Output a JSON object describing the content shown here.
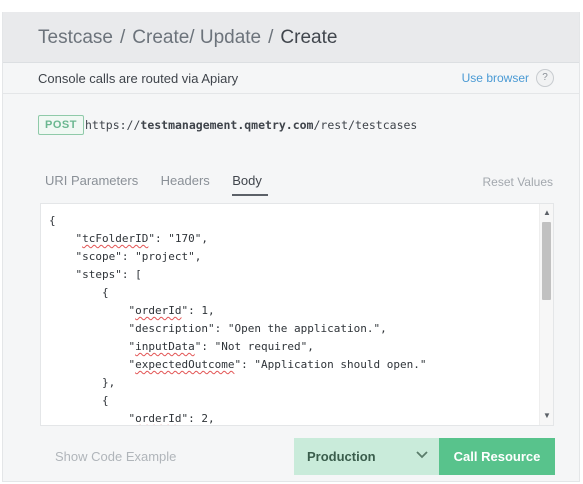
{
  "breadcrumb": {
    "items": [
      "Testcase",
      "Create/ Update",
      "Create"
    ],
    "separator": "/"
  },
  "console": {
    "text": "Console calls are routed via Apiary",
    "use_browser": "Use browser",
    "help": "?"
  },
  "request": {
    "method": "POST",
    "url_prefix": "https://",
    "url_host": "testmanagement.qmetry.com",
    "url_path": "/rest/testcases"
  },
  "tabs": [
    {
      "label": "URI Parameters",
      "active": false
    },
    {
      "label": "Headers",
      "active": false
    },
    {
      "label": "Body",
      "active": true
    }
  ],
  "reset_values": "Reset Values",
  "body_lines": [
    {
      "indent": "",
      "key": "",
      "rest": "{"
    },
    {
      "indent": "    ",
      "key": "tcFolderID",
      "rest": ": \"170\","
    },
    {
      "indent": "    ",
      "key": "",
      "rest": "\"scope\": \"project\","
    },
    {
      "indent": "    ",
      "key": "",
      "rest": "\"steps\": ["
    },
    {
      "indent": "        ",
      "key": "",
      "rest": "{"
    },
    {
      "indent": "            ",
      "key": "orderId",
      "rest": ": 1,"
    },
    {
      "indent": "            ",
      "key": "",
      "rest": "\"description\": \"Open the application.\","
    },
    {
      "indent": "            ",
      "key": "inputData",
      "rest": ": \"Not required\","
    },
    {
      "indent": "            ",
      "key": "expectedOutcome",
      "rest": ": \"Application should open.\""
    },
    {
      "indent": "        ",
      "key": "",
      "rest": "},"
    },
    {
      "indent": "        ",
      "key": "",
      "rest": "{"
    },
    {
      "indent": "            ",
      "key": "orderId",
      "rest": ": 2,"
    }
  ],
  "footer": {
    "show_code": "Show Code Example",
    "environment": "Production",
    "call_resource": "Call Resource"
  },
  "colors": {
    "accent_green": "#58c38c",
    "env_bg": "#c9ebda",
    "link_blue": "#4a9ad4",
    "method_badge": "#6bb790"
  }
}
